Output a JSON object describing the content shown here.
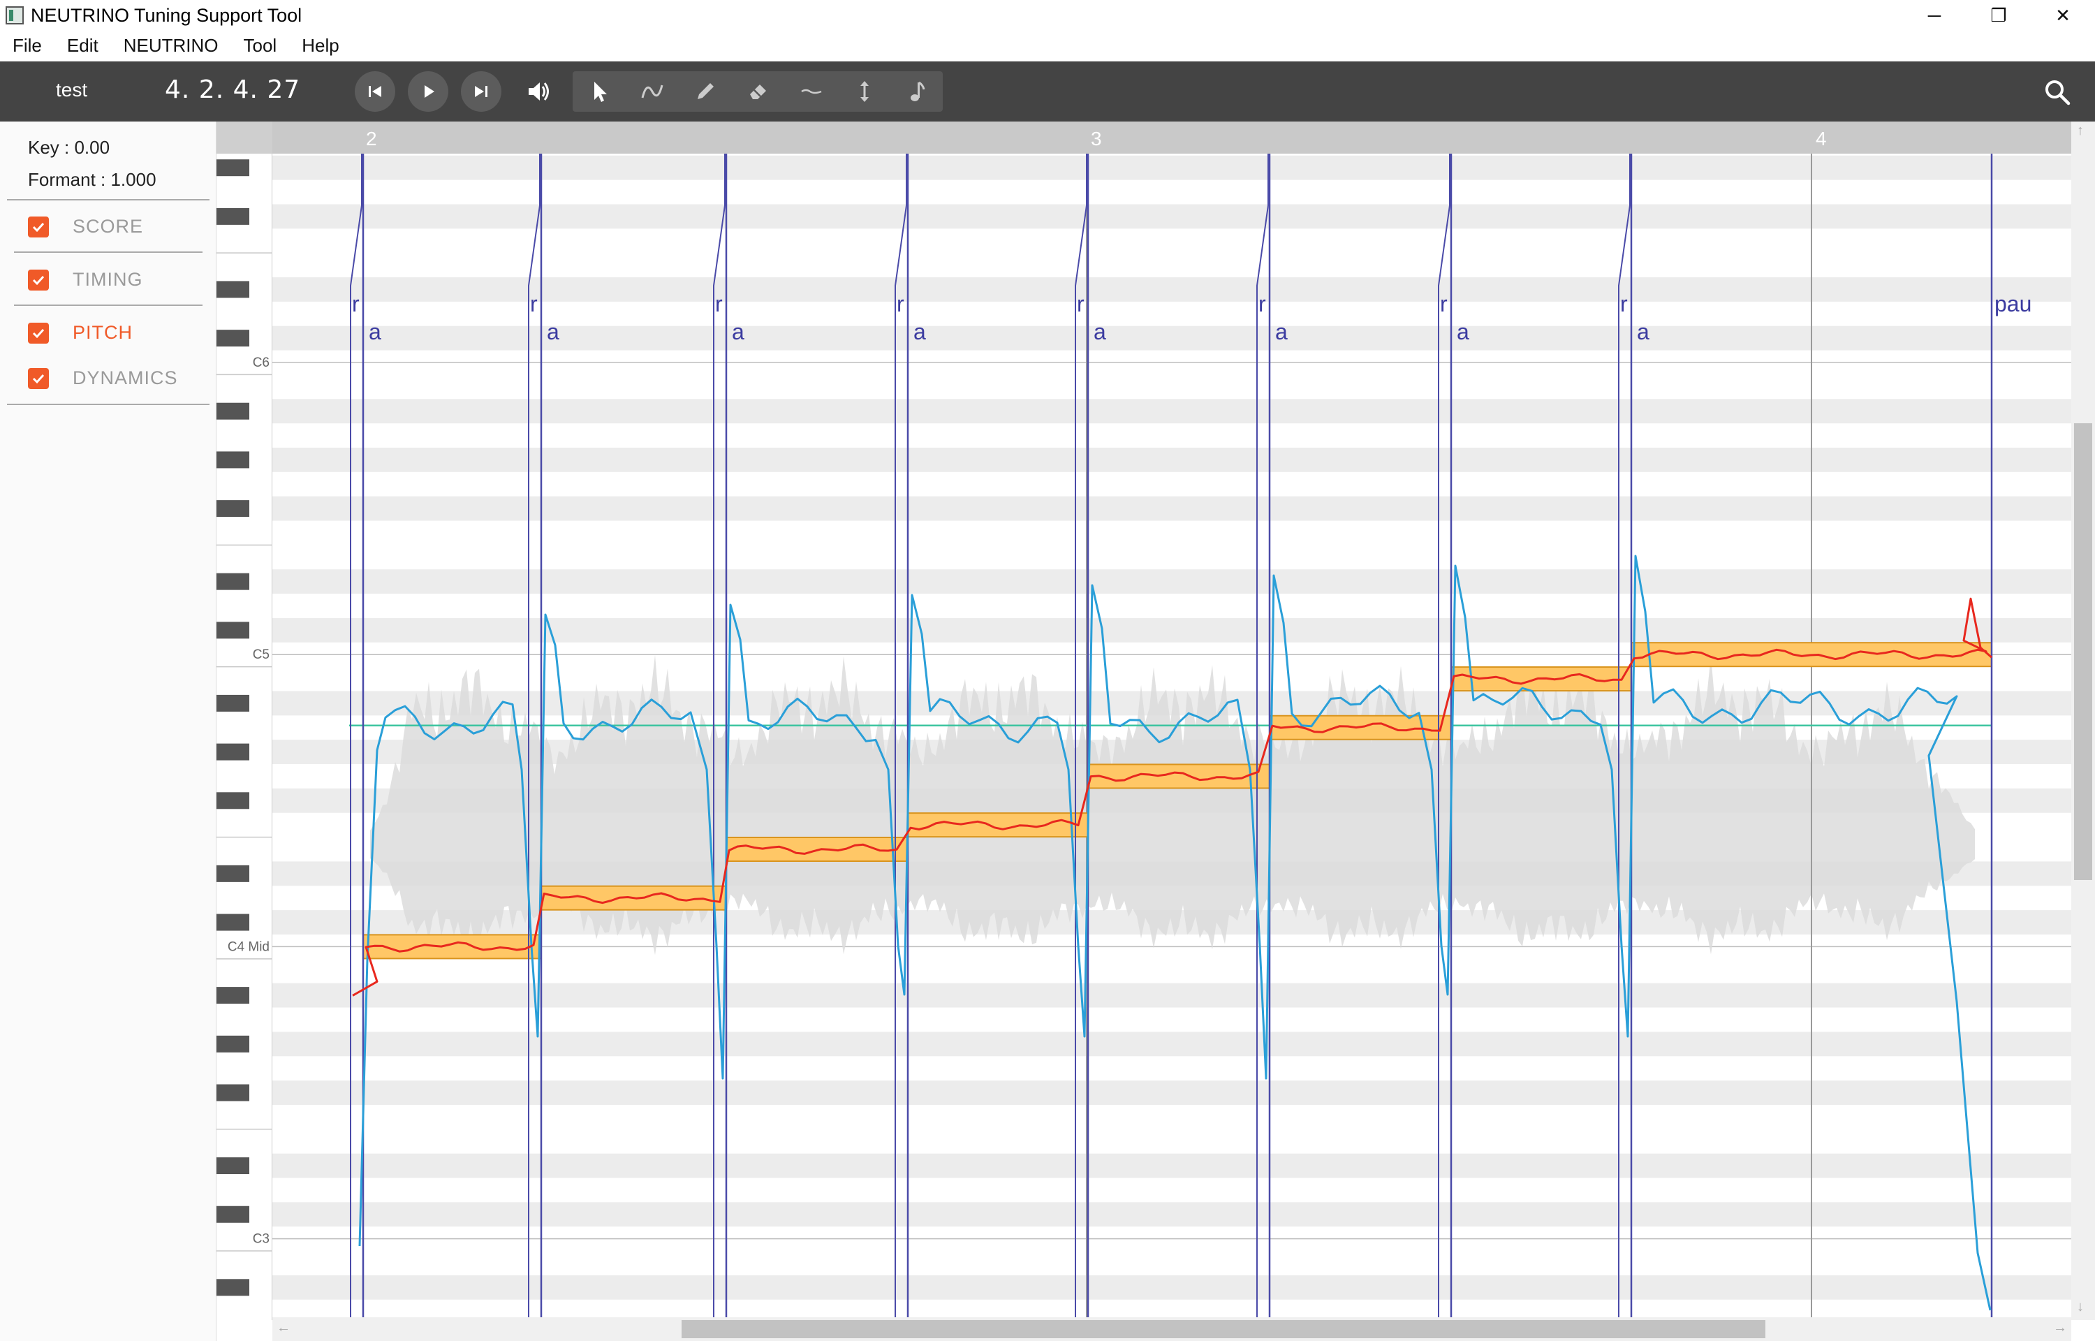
{
  "window": {
    "title": "NEUTRINO Tuning Support Tool",
    "controls": [
      "─",
      "❐",
      "✕"
    ]
  },
  "menu": [
    "File",
    "Edit",
    "NEUTRINO",
    "Tool",
    "Help"
  ],
  "toolbar": {
    "project_name": "test",
    "position": "4. 2. 4. 27",
    "transport": [
      "skip-back-icon",
      "play-icon",
      "skip-forward-icon",
      "volume-icon"
    ],
    "tools": [
      "select-arrow-icon",
      "pitch-curve-icon",
      "pencil-icon",
      "eraser-icon",
      "line-icon",
      "vertical-resize-icon",
      "note-icon"
    ],
    "search": "search-icon"
  },
  "panel": {
    "key": "Key : 0.00",
    "formant": "Formant : 1.000",
    "layers": [
      {
        "label": "SCORE",
        "checked": true,
        "active": false
      },
      {
        "label": "TIMING",
        "checked": true,
        "active": false
      },
      {
        "label": "PITCH",
        "checked": true,
        "active": true
      },
      {
        "label": "DYNAMICS",
        "checked": true,
        "active": false
      }
    ]
  },
  "piano": {
    "octave_labels": [
      "C6",
      "C5",
      "C4 Mid",
      "C3"
    ]
  },
  "ruler": {
    "measures": [
      "2",
      "3",
      "4"
    ]
  },
  "phonemes": [
    "r",
    "a",
    "r",
    "a",
    "r",
    "a",
    "r",
    "a",
    "r",
    "a",
    "r",
    "a",
    "r",
    "a",
    "r",
    "a",
    "pau"
  ],
  "colors": {
    "accent": "#f05a28",
    "toolbar_bg": "#444444",
    "note_fill": "#ffc766",
    "note_border": "#d9941e",
    "pitch_original": "#2a9fd8",
    "pitch_edited": "#e8281e",
    "timing_line": "#4a4aa8",
    "reference_line": "#3cc4a0",
    "waveform": "#dcdcdc"
  },
  "notes": [
    {
      "lyric": "a",
      "pitch": "C4"
    },
    {
      "lyric": "a",
      "pitch": "D4"
    },
    {
      "lyric": "a",
      "pitch": "E4"
    },
    {
      "lyric": "a",
      "pitch": "F4"
    },
    {
      "lyric": "a",
      "pitch": "G4"
    },
    {
      "lyric": "a",
      "pitch": "A4"
    },
    {
      "lyric": "a",
      "pitch": "B4"
    },
    {
      "lyric": "a",
      "pitch": "C5"
    }
  ]
}
